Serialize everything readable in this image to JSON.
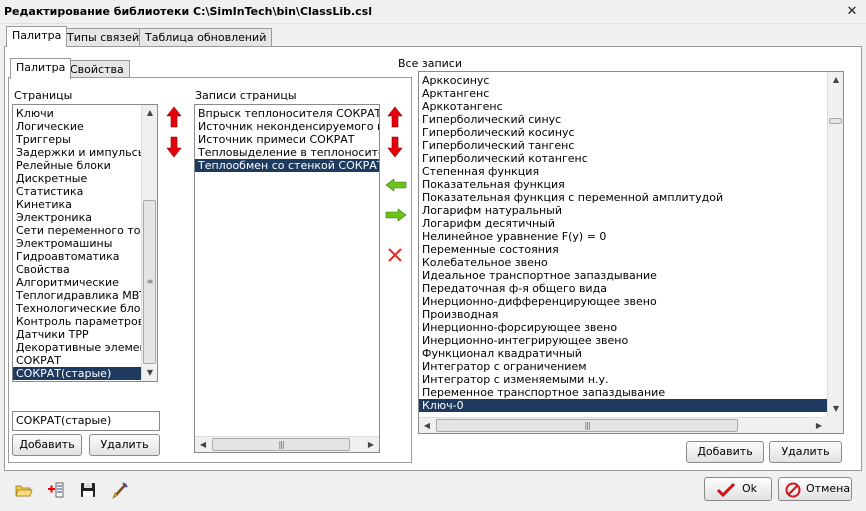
{
  "window": {
    "title": "Редактирование библиотеки  C:\\SimInTech\\bin\\ClassLib.csl",
    "close_glyph": "✕"
  },
  "outer_tabs": [
    "Палитра",
    "Типы связей",
    "Таблица обновлений"
  ],
  "inner_tabs": [
    "Палитра",
    "Свойства"
  ],
  "pages": {
    "label": "Страницы",
    "items": [
      "Ключи",
      "Логические",
      "Триггеры",
      "Задержки и импульсы",
      "Релейные блоки",
      "Дискретные",
      "Статистика",
      "Кинетика",
      "Электроника",
      "Сети переменного тока",
      "Электромашины",
      "Гидроавтоматика",
      "Свойства",
      "Алгоритмические",
      "Теплогидравлика МВТУ",
      "Технологические блоки",
      "Контроль параметров ТР",
      "Датчики ТРР",
      "Декоративные элементы",
      "СОКРАТ",
      "СОКРАТ(старые)"
    ],
    "selected_index": 20,
    "name_value": "СОКРАТ(старые)",
    "add_label": "Добавить",
    "delete_label": "Удалить"
  },
  "page_records": {
    "label": "Записи страницы",
    "items": [
      "Впрыск теплоносителя СОКРАТ",
      "Источник неконденсируемого газа",
      "Источник примеси СОКРАТ",
      "Тепловыделение в теплоноситель СОКРАТ",
      "Теплообмен со стенкой СОКРАТ"
    ],
    "selected_index": 4
  },
  "all_records": {
    "label": "Все записи",
    "items": [
      "Арккосинус",
      "Арктангенс",
      "Арккотангенс",
      "Гиперболический синус",
      "Гиперболический косинус",
      "Гиперболический тангенс",
      "Гиперболический котангенс",
      "Степенная функция",
      "Показательная функция",
      "Показательная функция с переменной амплитудой",
      "Логарифм натуральный",
      "Логарифм десятичный",
      "Нелинейное уравнение F(y) = 0",
      "Переменные состояния",
      "Колебательное звено",
      "Идеальное транспортное запаздывание",
      "Передаточная ф-я общего вида",
      "Инерционно-дифференцирующее звено",
      "Производная",
      "Инерционно-форсирующее звено",
      "Инерционно-интегрирующее звено",
      "Функционал квадратичный",
      "Интегратор с ограничением",
      "Интегратор с изменяемыми н.у.",
      "Переменное транспортное запаздывание",
      "Ключ-0"
    ],
    "selected_index": 25,
    "add_label": "Добавить",
    "delete_label": "Удалить"
  },
  "dialog": {
    "ok_label": "Ok",
    "cancel_label": "Отмена"
  },
  "colors": {
    "selection": "#1f3a5f",
    "arrow_red": "#e8000b",
    "arrow_green": "#6cc21a",
    "delete_red": "#e8291c"
  },
  "icons": [
    "open-folder-icon",
    "add-record-icon",
    "save-icon",
    "edit-brush-icon",
    "move-up-icon",
    "move-down-icon",
    "move-left-icon",
    "move-right-icon",
    "delete-icon",
    "checkmark-icon",
    "cancel-icon"
  ]
}
